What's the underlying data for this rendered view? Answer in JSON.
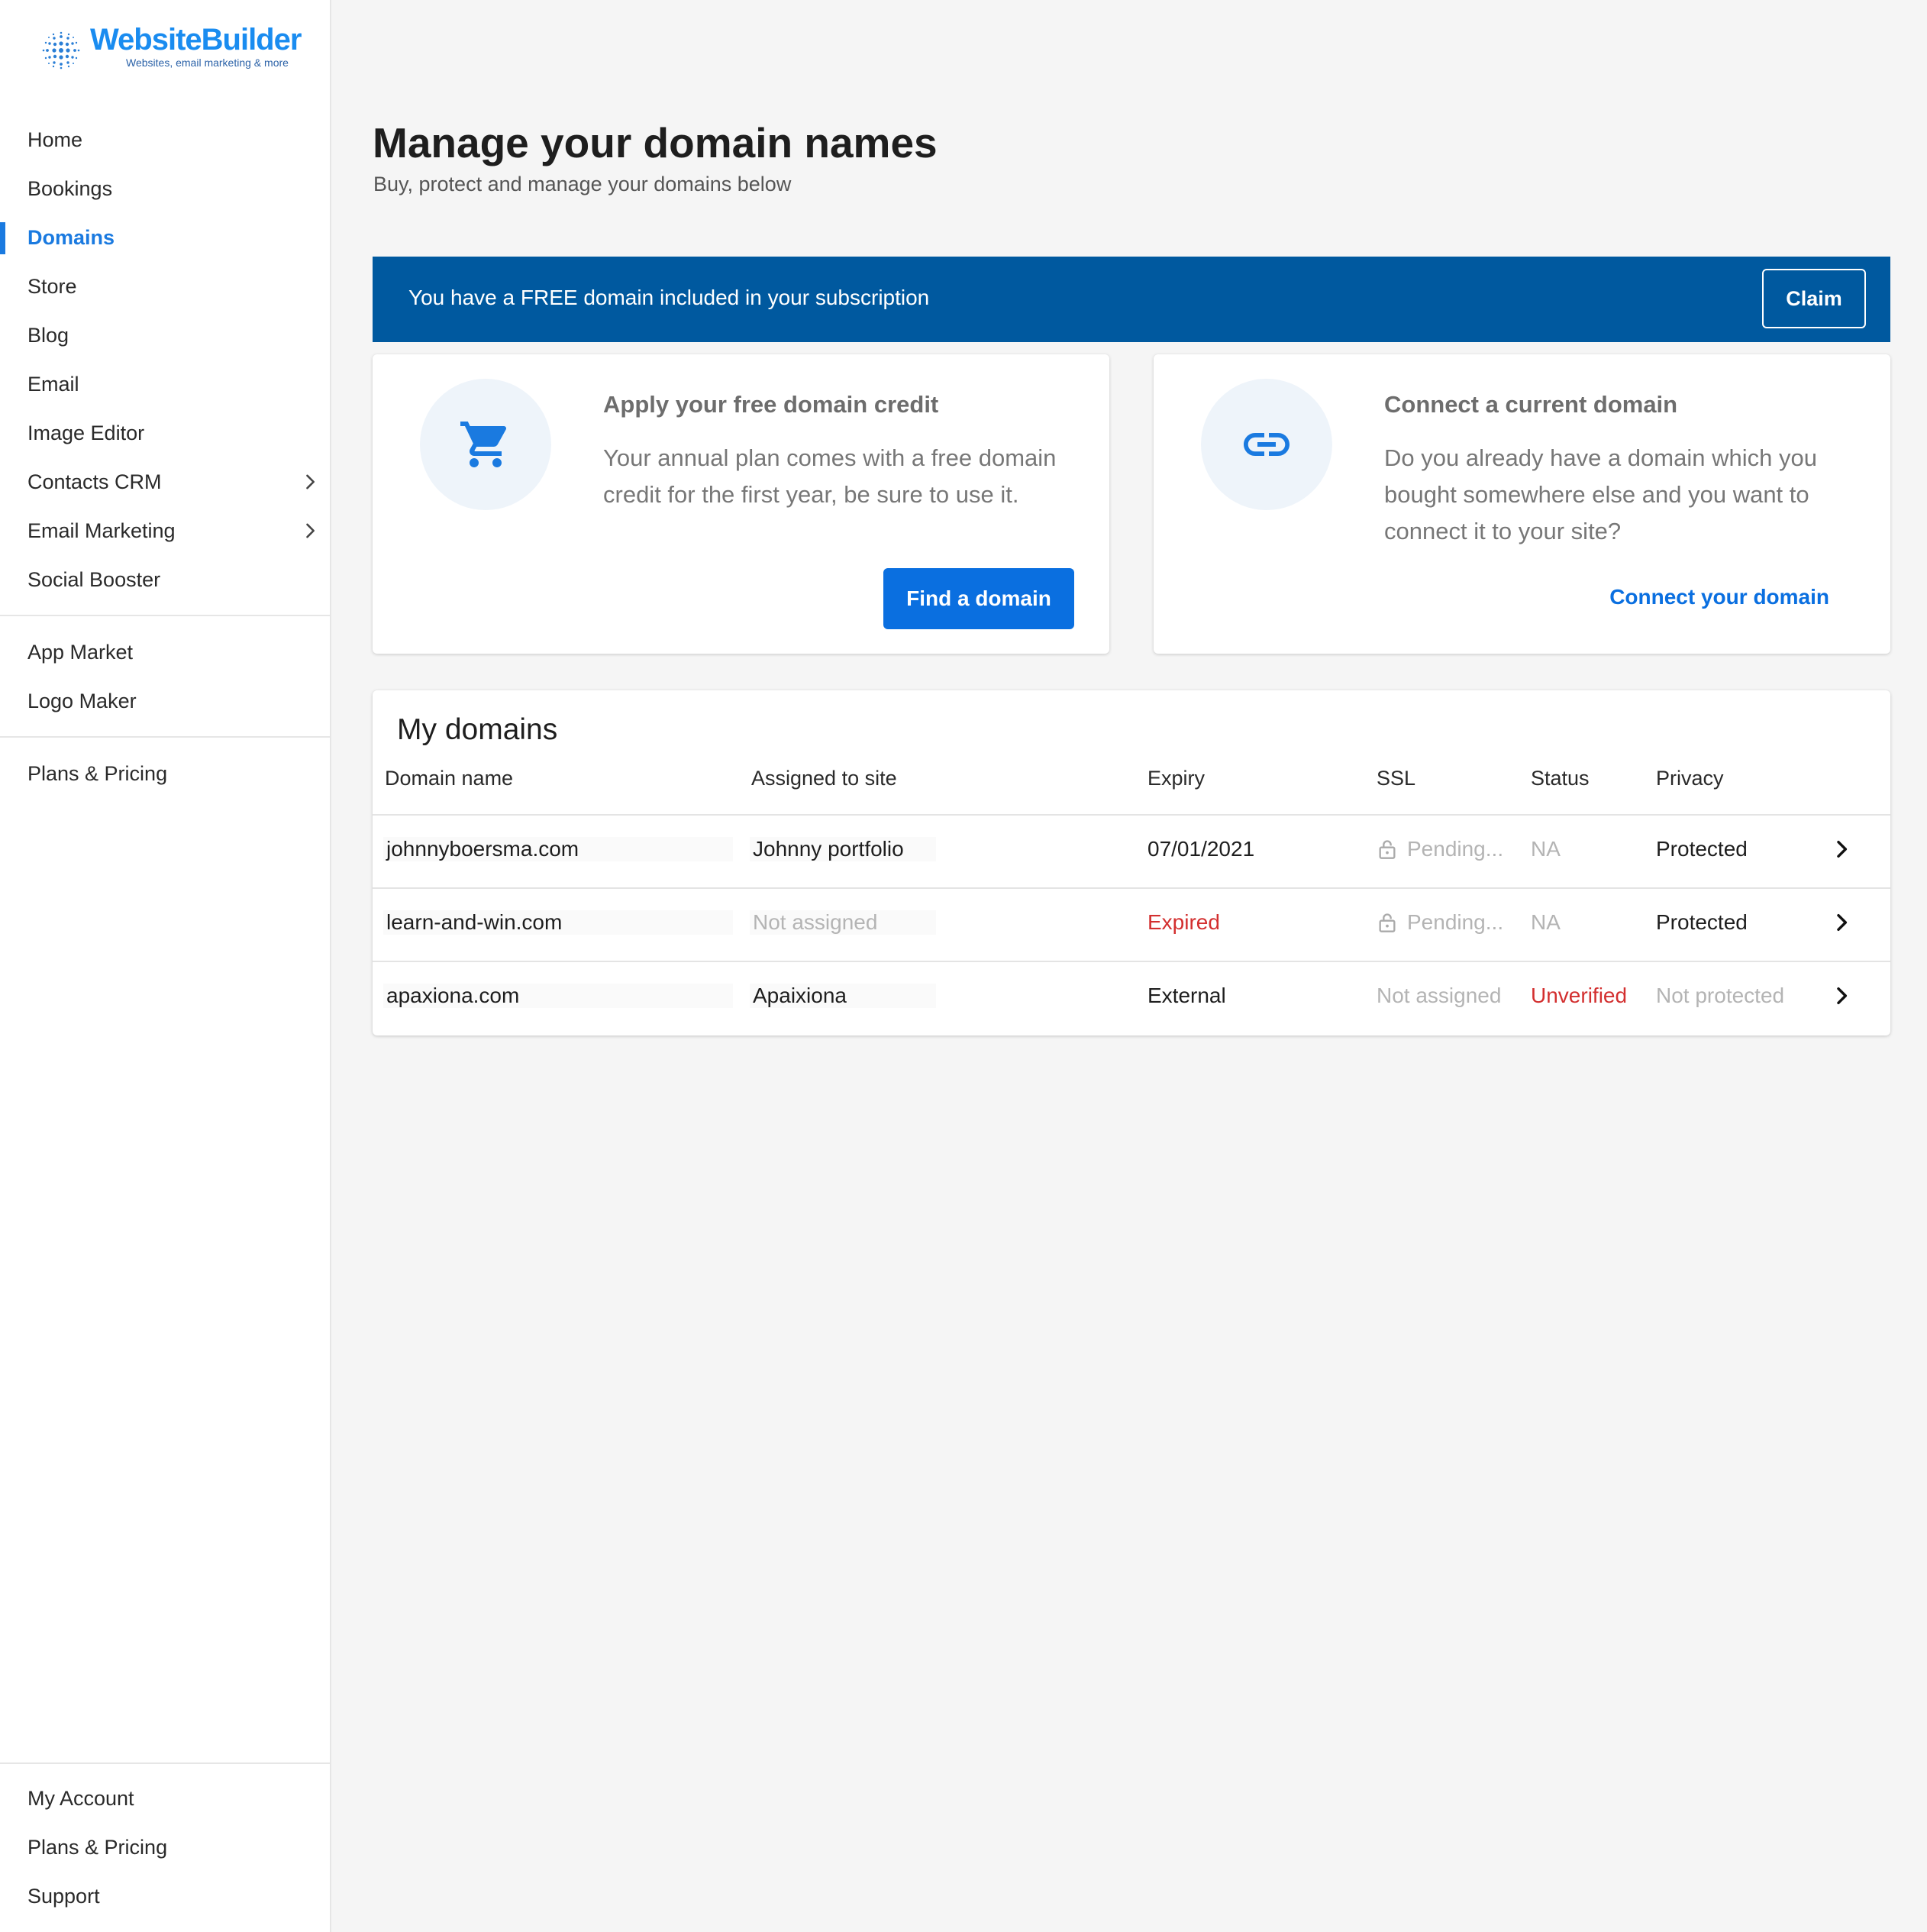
{
  "brand": {
    "name": "WebsiteBuilder",
    "tagline": "Websites, email marketing & more",
    "color": "#1a8cf0"
  },
  "sidebar": {
    "items": [
      {
        "label": "Home"
      },
      {
        "label": "Bookings"
      },
      {
        "label": "Domains",
        "active": true
      },
      {
        "label": "Store"
      },
      {
        "label": "Blog"
      },
      {
        "label": "Email"
      },
      {
        "label": "Image Editor"
      },
      {
        "label": "Contacts CRM",
        "icon": "chevron-right-icon"
      },
      {
        "label": "Email Marketing",
        "icon": "chevron-right-icon"
      },
      {
        "label": "Social Booster"
      },
      {
        "label": "App Market"
      },
      {
        "label": "Logo Maker"
      },
      {
        "label": "Plans & Pricing"
      }
    ],
    "footer": [
      {
        "label": "My Account"
      },
      {
        "label": "Plans & Pricing"
      },
      {
        "label": "Support"
      }
    ]
  },
  "header": {
    "title": "Manage your domain names",
    "subtitle": "Buy, protect and manage your domains below"
  },
  "banner": {
    "text": "You have a FREE domain included in your subscription",
    "button": "Claim",
    "color": "#00599f"
  },
  "cards": [
    {
      "icon": "shopping-cart-icon",
      "title": "Apply your free domain credit",
      "description": "Your annual plan comes with a free domain credit for the first year, be sure to use it.",
      "action": "Find a domain"
    },
    {
      "icon": "link-icon",
      "title": "Connect a current domain",
      "description": "Do you already have a domain which you bought somewhere else and you want to connect it to your site?",
      "action": "Connect your domain"
    }
  ],
  "domains": {
    "title": "My domains",
    "columns": [
      "Domain name",
      "Assigned to site",
      "Expiry",
      "SSL",
      "Status",
      "Privacy"
    ],
    "rows": [
      {
        "domain": "johnnyboersma.com",
        "site": "Johnny portfolio",
        "expiry": "07/01/2021",
        "ssl": "Pending...",
        "status": "NA",
        "privacy": "Protected"
      },
      {
        "domain": "learn-and-win.com",
        "site": "Not assigned",
        "expiry": "Expired",
        "ssl": "Pending...",
        "status": "NA",
        "privacy": "Protected"
      },
      {
        "domain": "apaxiona.com",
        "site": "Apaixiona",
        "expiry": "External",
        "ssl": "Not assigned",
        "status": "Unverified",
        "privacy": "Not protected"
      }
    ]
  },
  "colors": {
    "accent": "#1a7ae0",
    "primary_button": "#0a6fe0",
    "error": "#d32f2f",
    "muted": "#b4b4b4"
  }
}
